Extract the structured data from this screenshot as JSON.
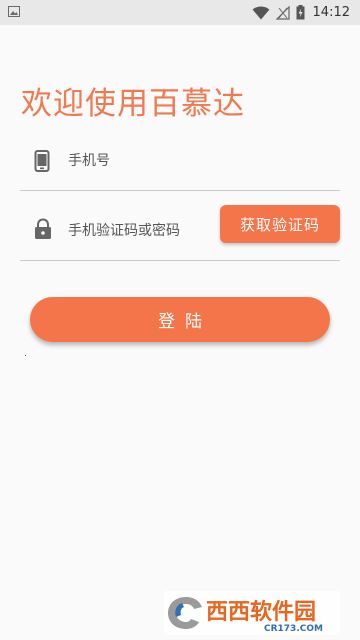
{
  "status_bar": {
    "time": "14:12",
    "icons": [
      "image-notification-icon",
      "wifi-icon",
      "signal-icon",
      "battery-icon"
    ]
  },
  "login": {
    "title": "欢迎使用百慕达",
    "phone_placeholder": "手机号",
    "phone_value": "",
    "code_placeholder": "手机验证码或密码",
    "code_value": "",
    "get_code_label": "获取验证码",
    "login_label": "登陆"
  },
  "watermark": {
    "brand": "西西软件园",
    "url": "CR173.COM",
    "colors": {
      "brand": "#e9651f",
      "blue": "#2f6fb6"
    }
  },
  "colors": {
    "accent": "#f5754a",
    "title": "#f07a50",
    "status_bar": "#e8e8e8",
    "background": "#fafafa",
    "icon_gray": "#666666",
    "divider": "#c9c9c9"
  }
}
